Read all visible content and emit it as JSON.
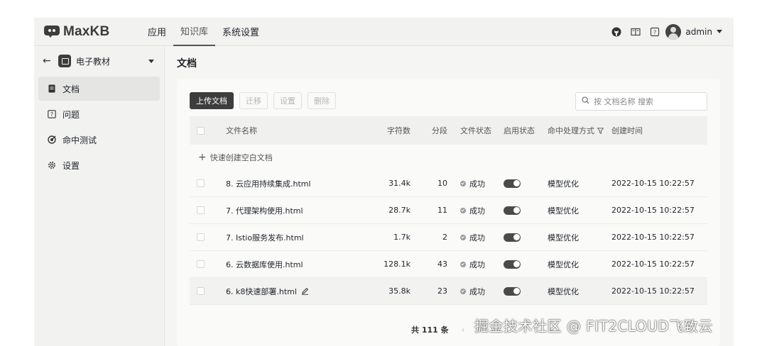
{
  "app": {
    "name": "MaxKB"
  },
  "nav": {
    "items": [
      "应用",
      "知识库",
      "系统设置"
    ]
  },
  "user": {
    "name": "admin"
  },
  "header_icons": [
    "github-icon",
    "docs-icon",
    "help-icon"
  ],
  "sidebar": {
    "knowledge_base": "电子教材",
    "items": [
      {
        "label": "文档",
        "icon": "document-icon",
        "active": true
      },
      {
        "label": "问题",
        "icon": "question-icon",
        "active": false
      },
      {
        "label": "命中测试",
        "icon": "target-icon",
        "active": false
      },
      {
        "label": "设置",
        "icon": "gear-icon",
        "active": false
      }
    ]
  },
  "page": {
    "title": "文档"
  },
  "toolbar": {
    "upload": "上传文档",
    "migrate": "迁移",
    "settings": "设置",
    "delete": "删除"
  },
  "search": {
    "placeholder": "按 文档名称 搜索",
    "value": ""
  },
  "table": {
    "headers": {
      "name": "文件名称",
      "chars": "字符数",
      "segments": "分段",
      "file_status": "文件状态",
      "enable_status": "启用状态",
      "hit_method": "命中处理方式",
      "created": "创建时间"
    },
    "quick_create": "快速创建空白文档",
    "rows": [
      {
        "name": "8. 云应用持续集成.html",
        "chars": "31.4k",
        "segments": "10",
        "status": "成功",
        "enabled": true,
        "hit": "模型优化",
        "created": "2022-10-15 10:22:57"
      },
      {
        "name": "7. 代理架构使用.html",
        "chars": "28.7k",
        "segments": "11",
        "status": "成功",
        "enabled": true,
        "hit": "模型优化",
        "created": "2022-10-15 10:22:57"
      },
      {
        "name": "7. Istio服务发布.html",
        "chars": "1.7k",
        "segments": "2",
        "status": "成功",
        "enabled": true,
        "hit": "模型优化",
        "created": "2022-10-15 10:22:57"
      },
      {
        "name": "6. 云数据库使用.html",
        "chars": "128.1k",
        "segments": "43",
        "status": "成功",
        "enabled": true,
        "hit": "模型优化",
        "created": "2022-10-15 10:22:57"
      },
      {
        "name": "6. k8快速部署.html",
        "chars": "35.8k",
        "segments": "23",
        "status": "成功",
        "enabled": true,
        "hit": "模型优化",
        "created": "2022-10-15 10:22:57"
      }
    ]
  },
  "pagination": {
    "total": "共 111 条"
  },
  "watermark": "掘金技术社区 @ FIT2CLOUD飞致云",
  "colors": {
    "primary": "#3d3d3d",
    "background": "#f5f5f4",
    "card": "#fafaf9"
  }
}
